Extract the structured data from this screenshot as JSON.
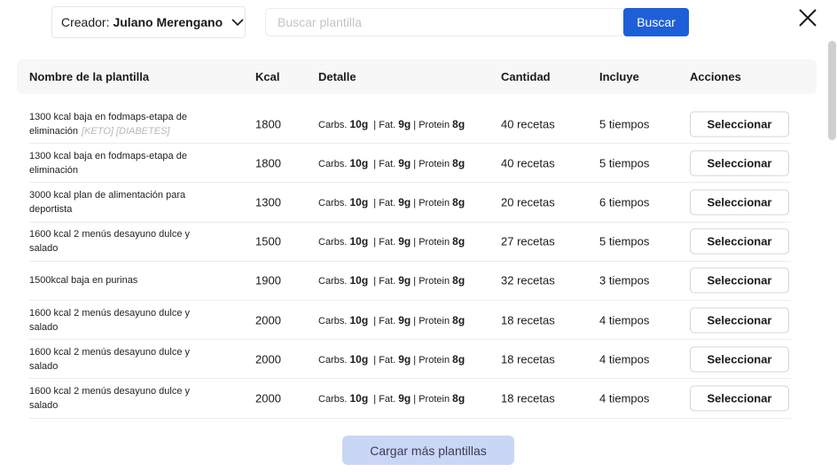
{
  "header": {
    "creator_label": "Creador:",
    "creator_value": "Julano Merengano",
    "search_placeholder": "Buscar plantilla",
    "search_value": "",
    "search_button": "Buscar"
  },
  "table": {
    "columns": [
      "Nombre de la plantilla",
      "Kcal",
      "Detalle",
      "Cantidad",
      "Incluye",
      "Acciones"
    ],
    "rows": [
      {
        "name": "1300 kcal baja en fodmaps-etapa de eliminación",
        "tags": "[KETO] [DIABETES]",
        "kcal": "1800",
        "carbs_label": "Carbs.",
        "carbs": "10g",
        "fat_label": "| Fat.",
        "fat": "9g",
        "protein_label": "| Protein",
        "protein": "8g",
        "qty": "40 recetas",
        "inc": "5 tiempos",
        "action": "Seleccionar"
      },
      {
        "name": "1300 kcal baja en fodmaps-etapa de eliminación",
        "tags": "",
        "kcal": "1800",
        "carbs_label": "Carbs.",
        "carbs": "10g",
        "fat_label": "| Fat.",
        "fat": "9g",
        "protein_label": "| Protein",
        "protein": "8g",
        "qty": "40 recetas",
        "inc": "5 tiempos",
        "action": "Seleccionar"
      },
      {
        "name": "3000 kcal plan de alimentación para deportista",
        "tags": "",
        "kcal": "1300",
        "carbs_label": "Carbs.",
        "carbs": "10g",
        "fat_label": "| Fat.",
        "fat": "9g",
        "protein_label": "| Protein",
        "protein": "8g",
        "qty": "20 recetas",
        "inc": "6 tiempos",
        "action": "Seleccionar"
      },
      {
        "name": "1600 kcal 2 menús desayuno dulce y salado",
        "tags": "",
        "kcal": "1500",
        "carbs_label": "Carbs.",
        "carbs": "10g",
        "fat_label": "| Fat.",
        "fat": "9g",
        "protein_label": "| Protein",
        "protein": "8g",
        "qty": "27 recetas",
        "inc": "5 tiempos",
        "action": "Seleccionar"
      },
      {
        "name": "1500kcal baja en purinas",
        "tags": "",
        "kcal": "1900",
        "carbs_label": "Carbs.",
        "carbs": "10g",
        "fat_label": "| Fat.",
        "fat": "9g",
        "protein_label": "| Protein",
        "protein": "8g",
        "qty": "32 recetas",
        "inc": "3 tiempos",
        "action": "Seleccionar"
      },
      {
        "name": "1600 kcal 2 menús desayuno dulce y salado",
        "tags": "",
        "kcal": "2000",
        "carbs_label": "Carbs.",
        "carbs": "10g",
        "fat_label": "| Fat.",
        "fat": "9g",
        "protein_label": "| Protein",
        "protein": "8g",
        "qty": "18 recetas",
        "inc": "4 tiempos",
        "action": "Seleccionar"
      },
      {
        "name": "1600 kcal 2 menús desayuno dulce y salado",
        "tags": "",
        "kcal": "2000",
        "carbs_label": "Carbs.",
        "carbs": "10g",
        "fat_label": "| Fat.",
        "fat": "9g",
        "protein_label": "| Protein",
        "protein": "8g",
        "qty": "18 recetas",
        "inc": "4 tiempos",
        "action": "Seleccionar"
      },
      {
        "name": "1600 kcal 2 menús desayuno dulce y salado",
        "tags": "",
        "kcal": "2000",
        "carbs_label": "Carbs.",
        "carbs": "10g",
        "fat_label": "| Fat.",
        "fat": "9g",
        "protein_label": "| Protein",
        "protein": "8g",
        "qty": "18 recetas",
        "inc": "4 tiempos",
        "action": "Seleccionar"
      }
    ]
  },
  "footer": {
    "load_more": "Cargar más plantillas"
  },
  "icons": {
    "creator_dropdown": "chevron-down-icon",
    "close": "close-icon"
  },
  "colors": {
    "accent": "#1e5fd8",
    "load_more_bg": "#c9d6f5",
    "header_bg": "#f7f7f7"
  }
}
